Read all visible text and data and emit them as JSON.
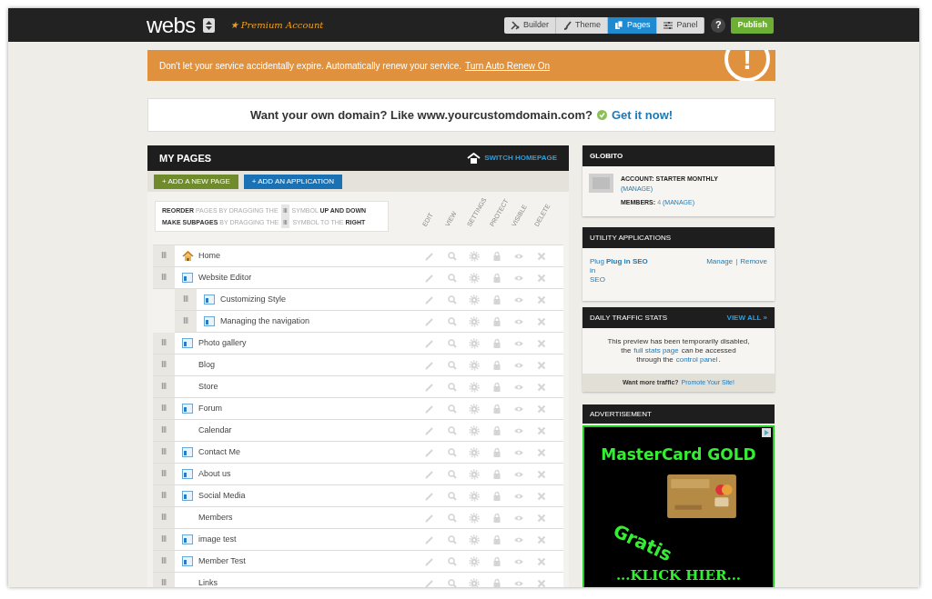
{
  "topbar": {
    "logo": "webs",
    "account": "★ Premium Account",
    "nav": [
      {
        "label": "Builder",
        "kind": "builder",
        "selected": false
      },
      {
        "label": "Theme",
        "kind": "theme",
        "selected": false
      },
      {
        "label": "Pages",
        "kind": "pages",
        "selected": true
      },
      {
        "label": "Panel",
        "kind": "panel",
        "selected": false
      }
    ],
    "help": "?",
    "publish": "Publish"
  },
  "banner": {
    "text": "Don't let your service accidentally expire. Automatically renew your service.",
    "link": "Turn Auto Renew On",
    "icon": "!"
  },
  "domain": {
    "text": "Want your own domain? Like www.yourcustomdomain.com?",
    "link": "Get it now!"
  },
  "my_pages": {
    "title": "MY PAGES",
    "switch_homepage": "SWITCH HOMEPAGE",
    "buttons": [
      {
        "label": "+ ADD A NEW PAGE",
        "kind": "green"
      },
      {
        "label": "+ ADD AN APPLICATION",
        "kind": "blue"
      }
    ],
    "instructions": [
      {
        "before": "**REORDER** PAGES BY DRAGGING THE",
        "handle": "Ⅲ",
        "after": "SYMBOL **UP AND DOWN**"
      },
      {
        "before": "**MAKE SUBPAGES** BY DRAGGING THE",
        "handle": "Ⅲ",
        "after": "SYMBOL TO THE **RIGHT**"
      }
    ],
    "columns": [
      "EDIT",
      "VIEW",
      "SETTINGS",
      "PROTECT",
      "VISIBLE",
      "DELETE"
    ],
    "pages": [
      {
        "name": "Home",
        "kind": "home",
        "handle": "Ⅲ"
      },
      {
        "name": "Website Editor",
        "kind": "page",
        "handle": "Ⅲ",
        "children": [
          {
            "name": "Customizing Style",
            "kind": "page",
            "handle": "Ⅲ"
          },
          {
            "name": "Managing the navigation",
            "kind": "page",
            "handle": "Ⅲ"
          }
        ]
      },
      {
        "name": "Photo gallery",
        "kind": "page",
        "handle": "Ⅲ"
      },
      {
        "name": "Blog",
        "kind": "plain",
        "handle": "Ⅲ"
      },
      {
        "name": "Store",
        "kind": "plain",
        "handle": "Ⅲ"
      },
      {
        "name": "Forum",
        "kind": "page",
        "handle": "Ⅲ"
      },
      {
        "name": "Calendar",
        "kind": "plain",
        "handle": "Ⅲ"
      },
      {
        "name": "Contact Me",
        "kind": "page",
        "handle": "Ⅲ"
      },
      {
        "name": "About us",
        "kind": "page",
        "handle": "Ⅲ"
      },
      {
        "name": "Social Media",
        "kind": "page",
        "handle": "Ⅲ"
      },
      {
        "name": "Members",
        "kind": "plain",
        "handle": "Ⅲ"
      },
      {
        "name": "image test",
        "kind": "page",
        "handle": "Ⅲ"
      },
      {
        "name": "Member Test",
        "kind": "page",
        "handle": "Ⅲ"
      },
      {
        "name": "Links",
        "kind": "plain",
        "handle": "Ⅲ"
      }
    ]
  },
  "site": {
    "title": "GLOBITO",
    "account_label": "ACCOUNT: STARTER MONTHLY",
    "account_manage": "(MANAGE)",
    "members_label": "MEMBERS:",
    "members_count": "4",
    "members_manage": "(MANAGE)"
  },
  "utility": {
    "title": "UTILITY APPLICATIONS",
    "app_link": "Plug in SEO",
    "app_name": "Plug in SEO",
    "manage": "Manage",
    "separator": "|",
    "remove": "Remove"
  },
  "traffic": {
    "title": "DAILY TRAFFIC STATS",
    "view_all": "VIEW ALL »",
    "line1": "This preview has been temporarily disabled,",
    "line2_pre": "the",
    "line2_link": "full stats page",
    "line2_post": "can be accessed",
    "line3_pre": "through the",
    "line3_link": "control panel",
    "line3_post": ".",
    "footer": "Want more traffic?",
    "footer_link": "Promote Your Site!"
  },
  "advertisement": {
    "title": "ADVERTISEMENT",
    "headline": "MasterCard GOLD",
    "stamp": "Gratis",
    "cta": "...KLICK HIER..."
  }
}
